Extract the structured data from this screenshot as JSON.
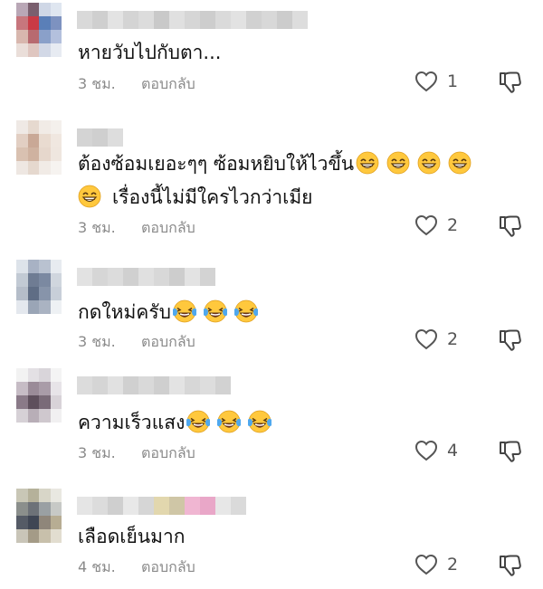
{
  "comments": [
    {
      "text": "หายวับไปกับตา...",
      "emojis": [],
      "time": "3 ชม.",
      "reply": "ตอบกลับ",
      "likes": "1",
      "avatar_colors": [
        "#b9a7b6",
        "#7a5f6e",
        "#cfd7e6",
        "#dfe6f0",
        "#c7767d",
        "#c93a45",
        "#5a7fb8",
        "#7d92c0",
        "#d8b7ae",
        "#b86a70",
        "#8aa0c9",
        "#b3c0dd",
        "#eaded9",
        "#dfc6c0",
        "#d2d8e6",
        "#e7ebf2"
      ],
      "name_colors": [
        "#d9d9d9",
        "#cfcfcf",
        "#e3e3e3",
        "#d4d4d4",
        "#dcdcdc",
        "#c9c9c9",
        "#e0e0e0",
        "#d6d6d6",
        "#cdcdcd",
        "#dadada",
        "#e2e2e2",
        "#d1d1d1",
        "#d8d8d8",
        "#cccccc",
        "#dddddd"
      ]
    },
    {
      "text": "ต้องซ้อมเยอะๆๆ ซ้อมหยิบให้ไวขึ้น",
      "emojis": [
        "grin",
        "grin",
        "grin",
        "grin"
      ],
      "text2": "เรื่องนี้ไม่มีใครไวกว่าเมีย",
      "emojis2_lead": [
        "grin"
      ],
      "time": "3 ชม.",
      "reply": "ตอบกลับ",
      "likes": "2",
      "avatar_colors": [
        "#efe9e5",
        "#e6d9cf",
        "#f1ebe6",
        "#f4f0ec",
        "#e2cfc3",
        "#c9a896",
        "#e9dbd0",
        "#f0e7e0",
        "#d9c1b1",
        "#cfb2a0",
        "#e6d7cc",
        "#efe6df",
        "#eee7e2",
        "#e5d8ce",
        "#f1ebe6",
        "#f6f3f0"
      ],
      "name_colors": [
        "#d4d4d4",
        "#cfcfcf",
        "#dddddd"
      ]
    },
    {
      "text": "กดใหม่ครับ",
      "emojis": [
        "joy",
        "joy",
        "joy"
      ],
      "time": "3 ชม.",
      "reply": "ตอบกลับ",
      "likes": "2",
      "avatar_colors": [
        "#dde3ea",
        "#a8b2c4",
        "#b9c2d0",
        "#e7ebf0",
        "#c2cad4",
        "#6f7c93",
        "#7b89a1",
        "#d0d6de",
        "#b5bdc9",
        "#5f6d85",
        "#8794aa",
        "#c8cfd9",
        "#e4e8ee",
        "#9aa5b6",
        "#aab3c2",
        "#eef1f4"
      ],
      "name_colors": [
        "#e2e2e2",
        "#d6d6d6",
        "#dcdcdc",
        "#d0d0d0",
        "#e0e0e0",
        "#d8d8d8",
        "#cdcdcd",
        "#e3e3e3",
        "#d3d3d3"
      ]
    },
    {
      "text": "ความเร็วแสง",
      "emojis": [
        "joy",
        "joy",
        "joy"
      ],
      "time": "3 ชม.",
      "reply": "ตอบกลับ",
      "likes": "4",
      "avatar_colors": [
        "#f2f2f2",
        "#e3e0e4",
        "#d9d5da",
        "#f4f4f4",
        "#c6bcc5",
        "#9a8b98",
        "#a99ca8",
        "#e7e4e8",
        "#8a7a88",
        "#5e4f5c",
        "#7a6b78",
        "#d8d3d8",
        "#d6d1d6",
        "#b8aeb7",
        "#cfc8ce",
        "#f1f0f1"
      ],
      "name_colors": [
        "#dcdcdc",
        "#d5d5d5",
        "#e1e1e1",
        "#d0d0d0",
        "#d9d9d9",
        "#cfcfcf",
        "#e3e3e3",
        "#d7d7d7",
        "#dddddd",
        "#d2d2d2"
      ]
    },
    {
      "text": "เลือดเย็นมาก",
      "emojis": [],
      "time": "4 ชม.",
      "reply": "ตอบกลับ",
      "likes": "2",
      "avatar_colors": [
        "#c9c7b6",
        "#b5b19a",
        "#d8d6c8",
        "#e9e8e1",
        "#8b8f8c",
        "#6d7278",
        "#9aa0a3",
        "#c7c9c6",
        "#555b66",
        "#3f4654",
        "#8f867a",
        "#b7ad93",
        "#c9c5b8",
        "#a49b87",
        "#c8c0ab",
        "#e2ddd0"
      ],
      "name_colors": [
        "#e5e5e5",
        "#dcdcdc",
        "#cfcfcf",
        "#e8e8e8",
        "#d6d6d6",
        "#e2d7ae",
        "#cfc6a6",
        "#f0b6d2",
        "#e9a7c8",
        "#e7e7e7",
        "#dadada"
      ]
    }
  ],
  "icons": {
    "like": "heart-outline-icon",
    "dislike": "thumbs-down-outline-icon"
  }
}
